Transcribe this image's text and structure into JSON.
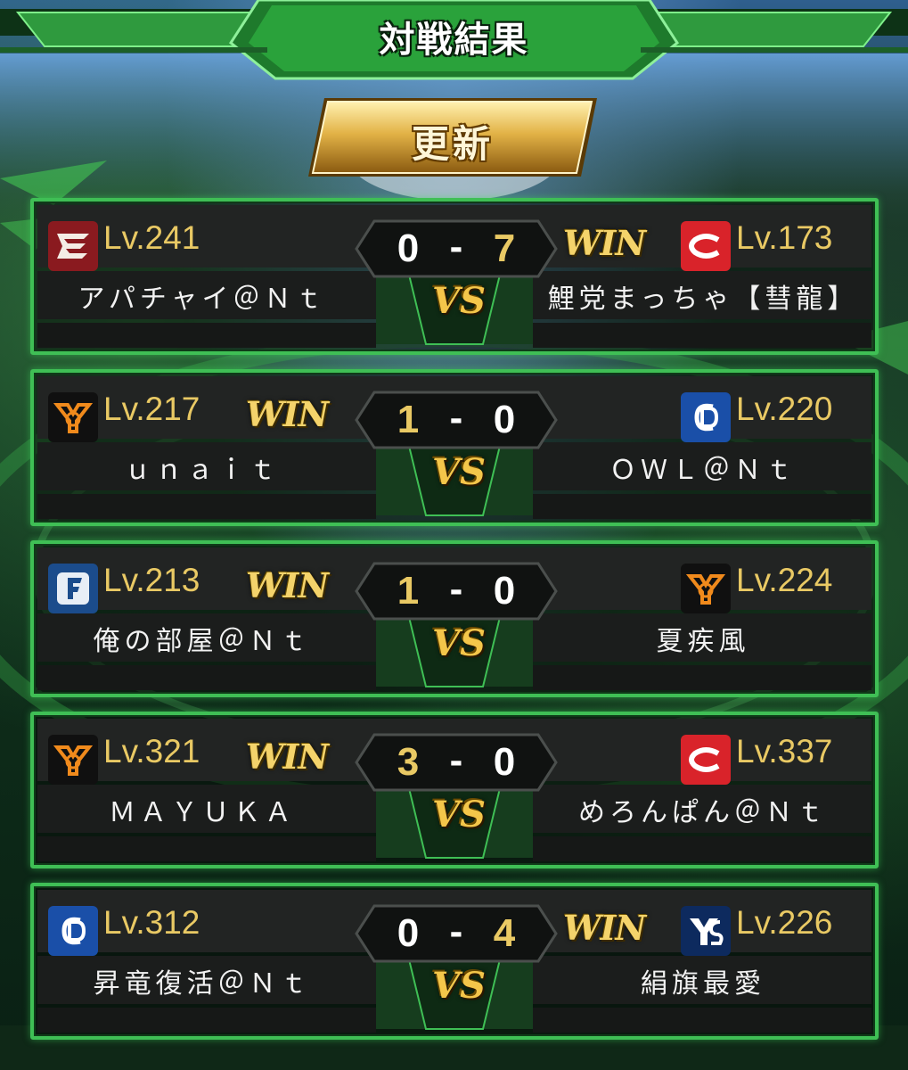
{
  "header": {
    "title": "対戦結果"
  },
  "refresh_button": {
    "label": "更新"
  },
  "vs_label": "VS",
  "win_label": "WIN",
  "dash": "-",
  "colors": {
    "frame_green": "#3fbf55",
    "gold": "#e9c964",
    "score_white": "#ffffff"
  },
  "matches": [
    {
      "left": {
        "team_icon": "eagles-e-icon",
        "level": "Lv.241",
        "name": "アパチャイ＠Ｎｔ",
        "score": "0",
        "win": false
      },
      "right": {
        "team_icon": "carp-c-icon",
        "level": "Lv.173",
        "name": "鯉党まっちゃ【彗龍】",
        "score": "7",
        "win": true
      }
    },
    {
      "left": {
        "team_icon": "giants-yg-icon",
        "level": "Lv.217",
        "name": "ｕｎａｉｔ",
        "score": "1",
        "win": true
      },
      "right": {
        "team_icon": "dragons-cd-icon",
        "level": "Lv.220",
        "name": "ＯＷＬ＠Ｎｔ",
        "score": "0",
        "win": false
      }
    },
    {
      "left": {
        "team_icon": "fighters-f-icon",
        "level": "Lv.213",
        "name": "俺の部屋＠Ｎｔ",
        "score": "1",
        "win": true
      },
      "right": {
        "team_icon": "giants-yg-icon",
        "level": "Lv.224",
        "name": "夏疾風",
        "score": "0",
        "win": false
      }
    },
    {
      "left": {
        "team_icon": "giants-yg-icon",
        "level": "Lv.321",
        "name": "ＭＡＹＵＫＡ",
        "score": "3",
        "win": true
      },
      "right": {
        "team_icon": "carp-c-icon",
        "level": "Lv.337",
        "name": "めろんぱん＠Ｎｔ",
        "score": "0",
        "win": false
      }
    },
    {
      "left": {
        "team_icon": "dragons-cd-icon",
        "level": "Lv.312",
        "name": "昇竜復活＠Ｎｔ",
        "score": "0",
        "win": false
      },
      "right": {
        "team_icon": "swallows-ys-icon",
        "level": "Lv.226",
        "name": "絹旗最愛",
        "score": "4",
        "win": true
      }
    }
  ]
}
